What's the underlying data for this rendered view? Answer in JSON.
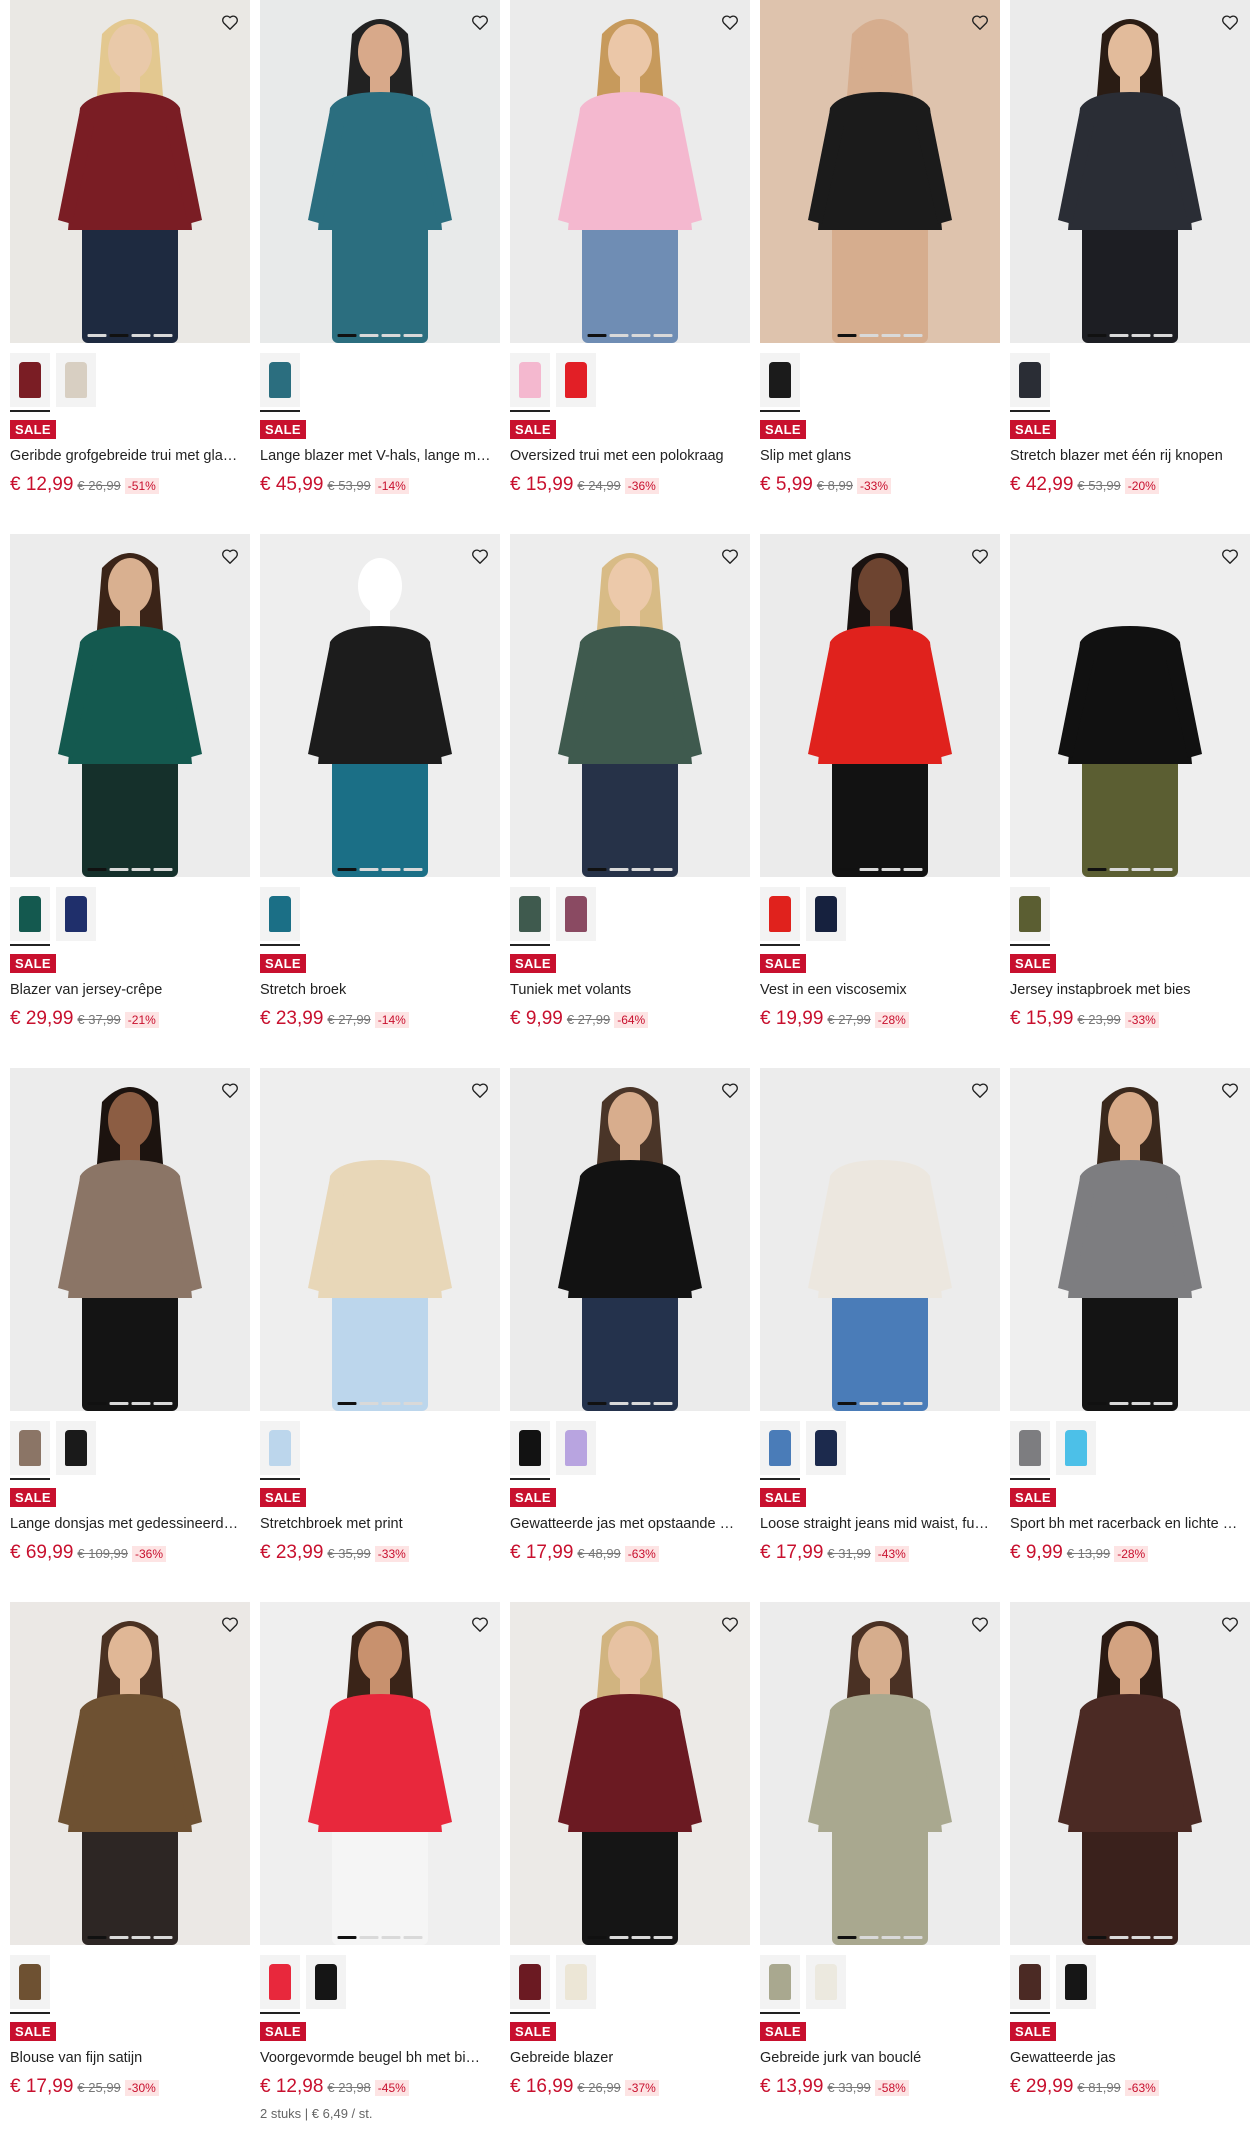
{
  "products": [
    {
      "title": "Geribde grofgebreide trui met gla…",
      "badge": "SALE",
      "price": "€ 12,99",
      "old_price": "€ 26,99",
      "discount": "-51%",
      "image_bg": "#eae8e4",
      "garment_color": "#7a1d24",
      "skin": "#e9c9a9",
      "hair": "#e3c890",
      "lower_color": "#1e2a40",
      "swatches": [
        "#7a1d24",
        "#d8cfc2"
      ],
      "dots": 4,
      "active_dot": 1
    },
    {
      "title": "Lange blazer met V-hals, lange m…",
      "badge": "SALE",
      "price": "€ 45,99",
      "old_price": "€ 53,99",
      "discount": "-14%",
      "image_bg": "#e8eaea",
      "garment_color": "#2b6e7f",
      "skin": "#d8a98a",
      "hair": "#222222",
      "lower_color": "#2b6e7f",
      "swatches": [
        "#2b6e7f"
      ],
      "dots": 4,
      "active_dot": 0
    },
    {
      "title": "Oversized trui met een polokraag",
      "badge": "SALE",
      "price": "€ 15,99",
      "old_price": "€ 24,99",
      "discount": "-36%",
      "image_bg": "#ebebeb",
      "garment_color": "#f4b8cf",
      "skin": "#ebc7a8",
      "hair": "#c79a5c",
      "lower_color": "#6f8db4",
      "swatches": [
        "#f4b8cf",
        "#e21f26"
      ],
      "dots": 4,
      "active_dot": 0
    },
    {
      "title": "Slip met glans",
      "badge": "SALE",
      "price": "€ 5,99",
      "old_price": "€ 8,99",
      "discount": "-33%",
      "image_bg": "#dec3ad",
      "garment_color": "#1b1b1b",
      "skin": "#d6ad8e",
      "hair": "#d6ad8e",
      "lower_color": "#d6ad8e",
      "swatches": [
        "#1b1b1b"
      ],
      "dots": 4,
      "active_dot": 0
    },
    {
      "title": "Stretch blazer met één rij knopen",
      "badge": "SALE",
      "price": "€ 42,99",
      "old_price": "€ 53,99",
      "discount": "-20%",
      "image_bg": "#ebebeb",
      "garment_color": "#2a2d35",
      "skin": "#e2bb9b",
      "hair": "#2a1c14",
      "lower_color": "#1d1e23",
      "swatches": [
        "#2a2d35"
      ],
      "dots": 4,
      "active_dot": 0
    },
    {
      "title": "Blazer van jersey-crêpe",
      "badge": "SALE",
      "price": "€ 29,99",
      "old_price": "€ 37,99",
      "discount": "-21%",
      "image_bg": "#ececec",
      "garment_color": "#14594f",
      "skin": "#d9b090",
      "hair": "#3b2418",
      "lower_color": "#15302b",
      "swatches": [
        "#14594f",
        "#1f2f6b"
      ],
      "dots": 4,
      "active_dot": 0
    },
    {
      "title": "Stretch broek",
      "badge": "SALE",
      "price": "€ 23,99",
      "old_price": "€ 27,99",
      "discount": "-14%",
      "image_bg": "#eeeeee",
      "garment_color": "#1c1c1c",
      "skin": "#ffffff",
      "hair": "#eeeeee",
      "lower_color": "#1b6f86",
      "swatches": [
        "#1b6f86"
      ],
      "dots": 4,
      "active_dot": 0
    },
    {
      "title": "Tuniek met volants",
      "badge": "SALE",
      "price": "€ 9,99",
      "old_price": "€ 27,99",
      "discount": "-64%",
      "image_bg": "#ededed",
      "garment_color": "#3f5a4e",
      "skin": "#ecc9aa",
      "hair": "#d8bb86",
      "lower_color": "#263248",
      "swatches": [
        "#3f5a4e",
        "#8a4a62"
      ],
      "dots": 4,
      "active_dot": 0
    },
    {
      "title": "Vest in een viscosemix",
      "badge": "SALE",
      "price": "€ 19,99",
      "old_price": "€ 27,99",
      "discount": "-28%",
      "image_bg": "#ebebeb",
      "garment_color": "#e0221d",
      "skin": "#6d4430",
      "hair": "#1a1210",
      "lower_color": "#121212",
      "swatches": [
        "#e0221d",
        "#16213e"
      ],
      "dots": 4,
      "active_dot": 0
    },
    {
      "title": "Jersey instapbroek met bies",
      "badge": "SALE",
      "price": "€ 15,99",
      "old_price": "€ 23,99",
      "discount": "-33%",
      "image_bg": "#eeeeee",
      "garment_color": "#111111",
      "skin": "#eeeeee",
      "hair": "#eeeeee",
      "lower_color": "#5b5e32",
      "swatches": [
        "#5b5e32"
      ],
      "dots": 4,
      "active_dot": 0
    },
    {
      "title": "Lange donsjas met gedessineerd…",
      "badge": "SALE",
      "price": "€ 69,99",
      "old_price": "€ 109,99",
      "discount": "-36%",
      "image_bg": "#ececec",
      "garment_color": "#8b7566",
      "skin": "#8c5d43",
      "hair": "#1c130f",
      "lower_color": "#141414",
      "swatches": [
        "#8b7566",
        "#1a1a1a"
      ],
      "dots": 4,
      "active_dot": 0
    },
    {
      "title": "Stretchbroek met print",
      "badge": "SALE",
      "price": "€ 23,99",
      "old_price": "€ 35,99",
      "discount": "-33%",
      "image_bg": "#eeeeee",
      "garment_color": "#e8d7b8",
      "skin": "#eeeeee",
      "hair": "#eeeeee",
      "lower_color": "#bcd6ec",
      "swatches": [
        "#bcd6ec"
      ],
      "dots": 4,
      "active_dot": 0
    },
    {
      "title": "Gewatteerde jas met opstaande …",
      "badge": "SALE",
      "price": "€ 17,99",
      "old_price": "€ 48,99",
      "discount": "-63%",
      "image_bg": "#ebebeb",
      "garment_color": "#121212",
      "skin": "#d8ad8d",
      "hair": "#4a3528",
      "lower_color": "#24324c",
      "swatches": [
        "#121212",
        "#b8a4e0"
      ],
      "dots": 4,
      "active_dot": 0
    },
    {
      "title": "Loose straight jeans mid waist, fu…",
      "badge": "SALE",
      "price": "€ 17,99",
      "old_price": "€ 31,99",
      "discount": "-43%",
      "image_bg": "#ececec",
      "garment_color": "#ece7df",
      "skin": "#ececec",
      "hair": "#ececec",
      "lower_color": "#4a7cb8",
      "swatches": [
        "#4a7cb8",
        "#1c2a4d"
      ],
      "dots": 4,
      "active_dot": 0
    },
    {
      "title": "Sport bh met racerback en lichte …",
      "badge": "SALE",
      "price": "€ 9,99",
      "old_price": "€ 13,99",
      "discount": "-28%",
      "image_bg": "#efefef",
      "garment_color": "#7d7d80",
      "skin": "#d9ab89",
      "hair": "#3a281c",
      "lower_color": "#141414",
      "swatches": [
        "#7d7d80",
        "#4cc0e8"
      ],
      "dots": 4,
      "active_dot": 0
    },
    {
      "title": "Blouse van fijn satijn",
      "badge": "SALE",
      "price": "€ 17,99",
      "old_price": "€ 25,99",
      "discount": "-30%",
      "image_bg": "#ebe8e5",
      "garment_color": "#6e5132",
      "skin": "#e0b796",
      "hair": "#4a3122",
      "lower_color": "#2d2624",
      "swatches": [
        "#6e5132"
      ],
      "dots": 4,
      "active_dot": 0
    },
    {
      "title": "Voorgevormde beugel bh met bi…",
      "badge": "SALE",
      "price": "€ 12,98",
      "old_price": "€ 23,98",
      "discount": "-45%",
      "extra": "2 stuks | € 6,49 / st.",
      "image_bg": "#efefef",
      "garment_color": "#e8283c",
      "skin": "#c8916e",
      "hair": "#3a2418",
      "lower_color": "#f5f5f5",
      "swatches": [
        "#e8283c",
        "#151515"
      ],
      "dots": 4,
      "active_dot": 0
    },
    {
      "title": "Gebreide blazer",
      "badge": "SALE",
      "price": "€ 16,99",
      "old_price": "€ 26,99",
      "discount": "-37%",
      "image_bg": "#eceae7",
      "garment_color": "#6b1a22",
      "skin": "#e7c2a2",
      "hair": "#d1b480",
      "lower_color": "#151515",
      "swatches": [
        "#6b1a22",
        "#ece6d6"
      ],
      "dots": 4,
      "active_dot": 0
    },
    {
      "title": "Gebreide jurk van bouclé",
      "badge": "SALE",
      "price": "€ 13,99",
      "old_price": "€ 33,99",
      "discount": "-58%",
      "image_bg": "#ececec",
      "garment_color": "#a9a88f",
      "skin": "#d6ad8d",
      "hair": "#4a3124",
      "lower_color": "#a9a88f",
      "swatches": [
        "#a9a88f",
        "#ece9df"
      ],
      "dots": 4,
      "active_dot": 0
    },
    {
      "title": "Gewatteerde jas",
      "badge": "SALE",
      "price": "€ 29,99",
      "old_price": "€ 81,99",
      "discount": "-63%",
      "image_bg": "#ececec",
      "garment_color": "#4b2a24",
      "skin": "#d3a381",
      "hair": "#2b1a13",
      "lower_color": "#3a211c",
      "swatches": [
        "#4b2a24",
        "#161616"
      ],
      "dots": 4,
      "active_dot": 0
    }
  ],
  "icons": {
    "wishlist": "heart-outline-icon"
  }
}
